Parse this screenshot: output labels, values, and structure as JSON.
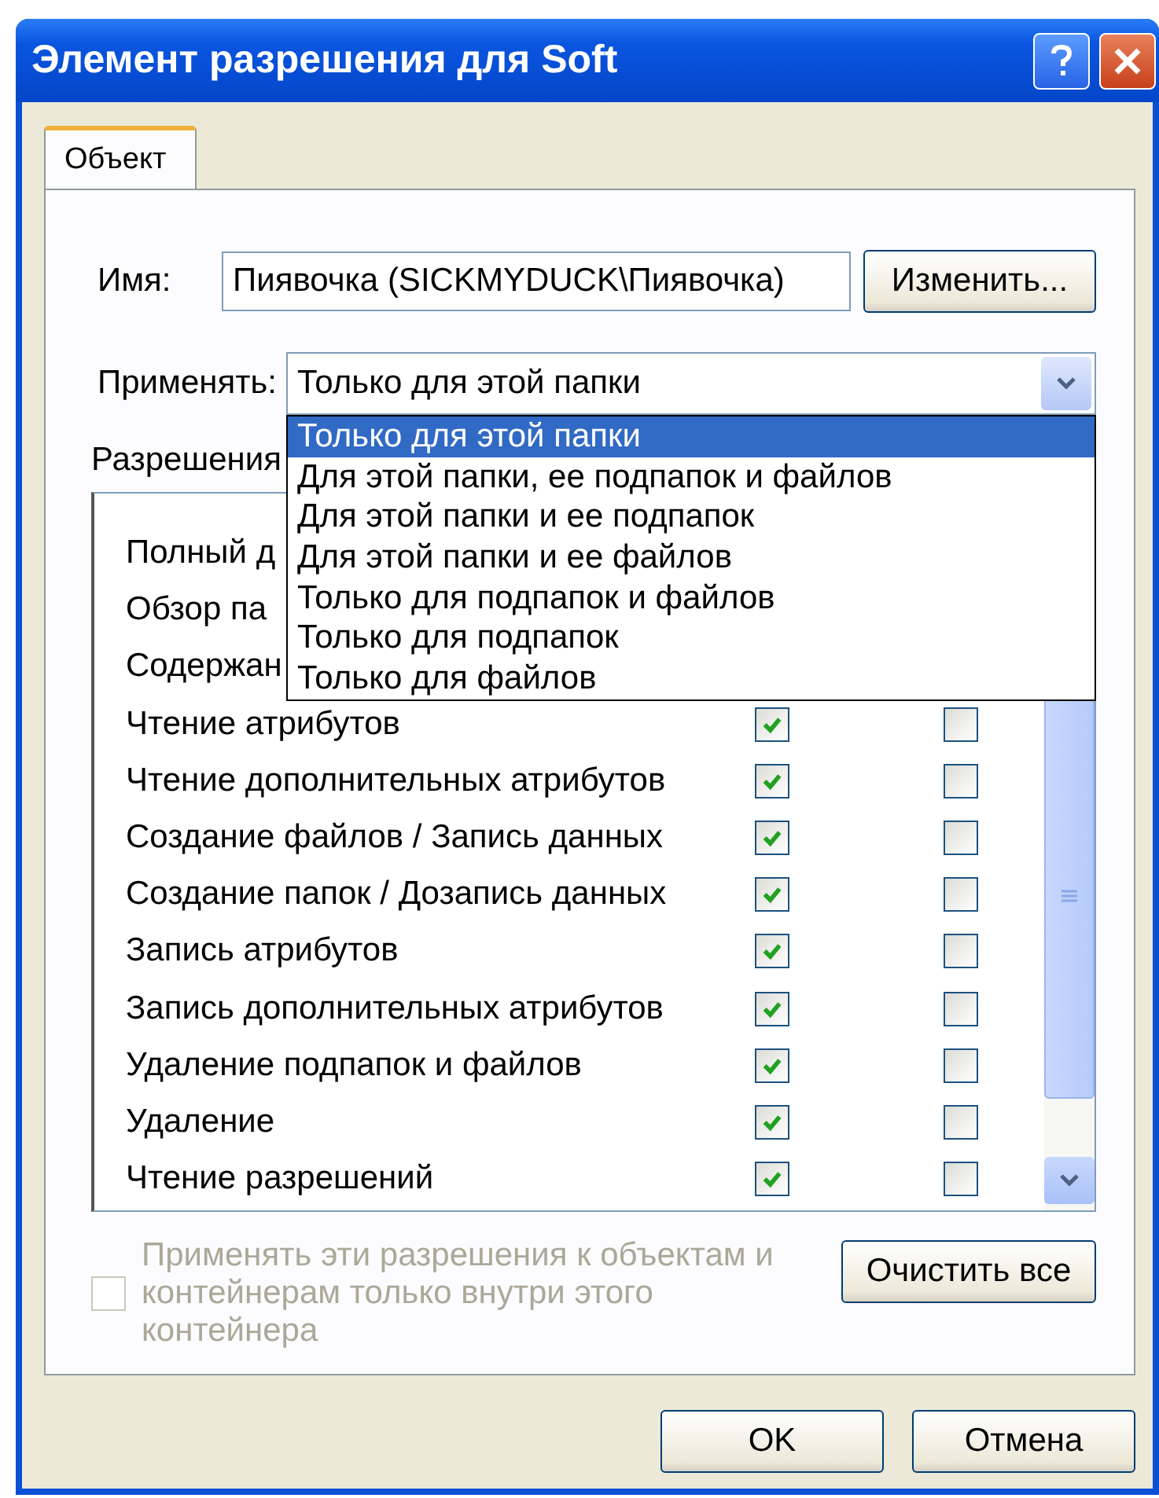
{
  "window": {
    "title": "Элемент разрешения для Soft"
  },
  "tabs": [
    {
      "label": "Объект",
      "selected": true
    }
  ],
  "name": {
    "label": "Имя:",
    "value": "Пиявочка (SICKMYDUCK\\Пиявочка)",
    "button": "Изменить..."
  },
  "apply": {
    "label": "Применять:",
    "value": "Только для этой папки",
    "expanded": true,
    "options": [
      {
        "label": "Только для этой папки",
        "selected": true
      },
      {
        "label": "Для этой папки, ее подпапок и файлов",
        "selected": false
      },
      {
        "label": "Для этой папки и ее подпапок",
        "selected": false
      },
      {
        "label": "Для этой папки и ее файлов",
        "selected": false
      },
      {
        "label": "Только для подпапок и файлов",
        "selected": false
      },
      {
        "label": "Только для подпапок",
        "selected": false
      },
      {
        "label": "Только для файлов",
        "selected": false
      }
    ]
  },
  "permissions": {
    "label": "Разрешения",
    "rows": [
      {
        "name": "Полный д"
      },
      {
        "name": "Обзор па"
      },
      {
        "name": "Содержан"
      },
      {
        "name": "Чтение атрибутов",
        "allow": true,
        "deny": false
      },
      {
        "name": "Чтение дополнительных атрибутов",
        "allow": true,
        "deny": false
      },
      {
        "name": "Создание файлов / Запись данных",
        "allow": true,
        "deny": false
      },
      {
        "name": "Создание папок / Дозапись данных",
        "allow": true,
        "deny": false
      },
      {
        "name": "Запись атрибутов",
        "allow": true,
        "deny": false
      },
      {
        "name": "Запись дополнительных атрибутов",
        "allow": true,
        "deny": false
      },
      {
        "name": "Удаление подпапок и файлов",
        "allow": true,
        "deny": false
      },
      {
        "name": "Удаление",
        "allow": true,
        "deny": false
      },
      {
        "name": "Чтение разрешений",
        "allow": true,
        "deny": false
      }
    ]
  },
  "inherit_option": {
    "label": "Применять эти разрешения к объектам и контейнерам только внутри этого контейнера",
    "checked": false,
    "disabled": true
  },
  "clear_button": "Очистить все",
  "buttons": [
    "OK",
    "Отмена"
  ]
}
